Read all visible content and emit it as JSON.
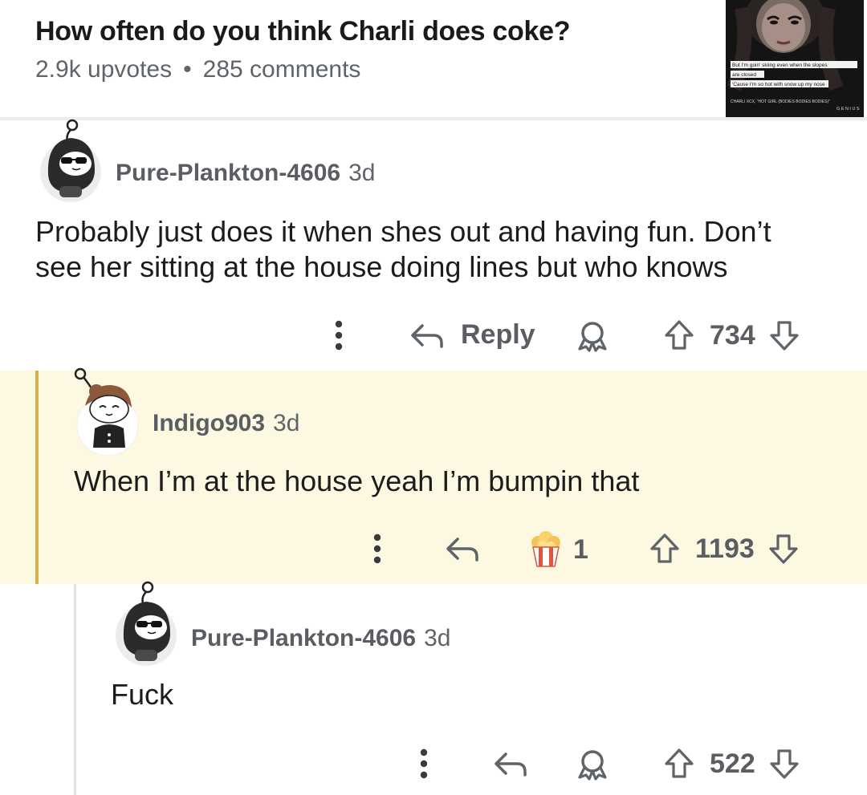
{
  "post": {
    "title": "How often do you think Charli does coke?",
    "upvotes": "2.9k upvotes",
    "separator": "•",
    "comments": "285 comments",
    "thumbnail": {
      "lyric_1": "But I'm goin' skiing even when the slopes",
      "lyric_2": "are closed",
      "lyric_3": "'Cause I'm so hot with snow up my nose",
      "credit": "CHARLI XCX, \"HOT GIRL (BODIES BODIES BODIES)\"",
      "brand": "GENIUS"
    }
  },
  "comments": [
    {
      "username": "Pure-Plankton-4606",
      "age": "3d",
      "body_line1": "Probably just does it when shes out and having fun. Don’t",
      "body_line2": "see her sitting at the house doing lines but who knows",
      "reply_label": "Reply",
      "score": "734"
    },
    {
      "username": "Indigo903",
      "age": "3d",
      "body": "When I’m at the house yeah I’m bumpin that",
      "award_count": "1",
      "score": "1193"
    },
    {
      "username": "Pure-Plankton-4606",
      "age": "3d",
      "body": "Fuck",
      "score": "522"
    }
  ],
  "colors": {
    "highlight": "#fdf8e1",
    "thread_accent": "#d4b14a",
    "meta_gray": "#5f6468"
  }
}
